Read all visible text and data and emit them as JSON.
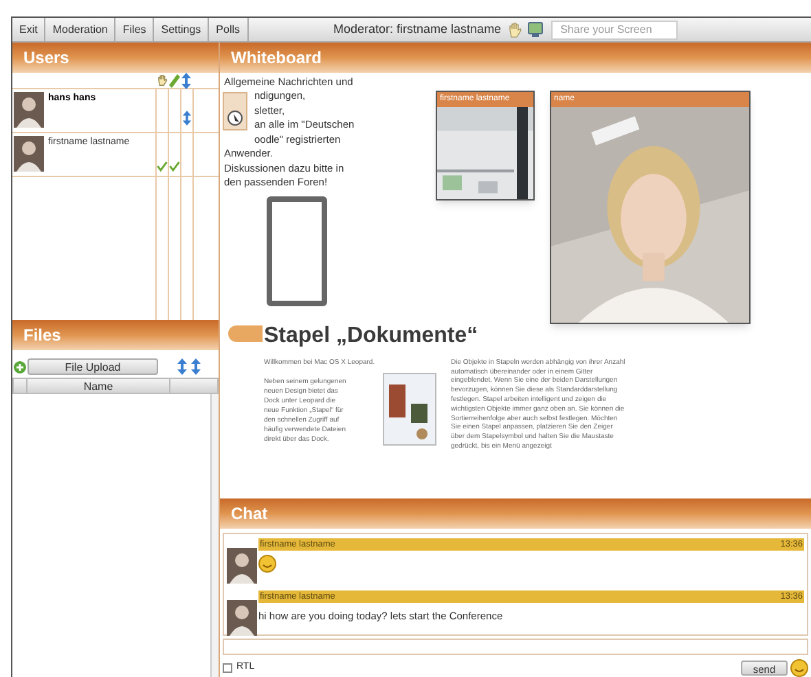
{
  "menu": [
    "Exit",
    "Moderation",
    "Files",
    "Settings",
    "Polls"
  ],
  "moderator_label": "Moderator: firstname lastname",
  "share_screen": {
    "placeholder": "Share your Screen"
  },
  "users": {
    "title": "Users",
    "rows": [
      {
        "name": "hans hans",
        "bold": true,
        "audio": false,
        "video": false,
        "moderator": true
      },
      {
        "name": "firstname lastname",
        "bold": false,
        "audio": true,
        "video": true,
        "moderator": false
      }
    ]
  },
  "files": {
    "title": "Files",
    "upload_button": "File Upload",
    "columns": [
      "Name"
    ]
  },
  "whiteboard": {
    "title": "Whiteboard",
    "note_lines": [
      "Allgemeine Nachrichten und",
      "ndigungen,",
      "sletter,",
      "an alle im \"Deutschen",
      "oodle\" registrierten",
      "Anwender.",
      "Diskussionen dazu bitte in",
      "den passenden Foren!"
    ],
    "document": {
      "heading": "Stapel „Dokumente“",
      "intro": "Willkommen bei Mac OS X Leopard.",
      "left_text": "Neben seinem gelungenen neuen Design bietet das Dock unter Leopard die neue Funktion „Stapel“ für den schnellen Zugriff auf häufig verwendete Dateien direkt über das Dock.",
      "right_text": "Die Objekte in Stapeln werden abhängig von ihrer Anzahl automatisch übereinander oder in einem Gitter eingeblendet. Wenn Sie eine der beiden Darstellungen bevorzugen, können Sie diese als Standarddarstellung festlegen. Stapel arbeiten intelligent und zeigen die wichtigsten Objekte immer ganz oben an. Sie können die Sortierreihenfolge aber auch selbst festlegen. Möchten Sie einen Stapel anpassen, platzieren Sie den Zeiger über dem Stapelsymbol und halten Sie die Maustaste gedrückt, bis ein Menü angezeigt"
    },
    "videos": [
      {
        "title": "firstname lastname",
        "kind": "room"
      },
      {
        "title": "name",
        "kind": "person"
      }
    ]
  },
  "chat": {
    "title": "Chat",
    "messages": [
      {
        "name": "firstname lastname",
        "time": "13:36",
        "kind": "emoji"
      },
      {
        "name": "firstname lastname",
        "time": "13:36",
        "kind": "text",
        "text": "hi how are you doing today? lets start the Conference"
      }
    ],
    "rtl": {
      "label": "RTL",
      "checked": false
    },
    "send_button": "send"
  }
}
